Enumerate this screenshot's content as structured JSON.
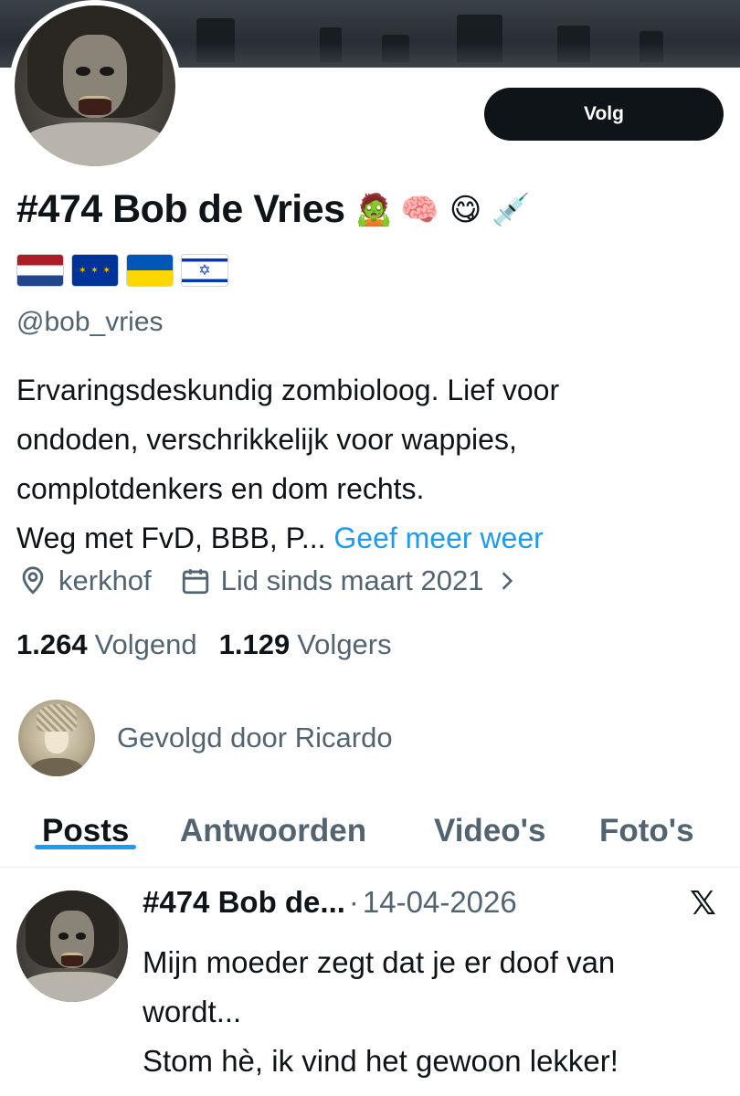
{
  "profile": {
    "display_name": "#474 Bob de Vries",
    "name_emojis": [
      "🧟",
      "🧠",
      "😋",
      "💉"
    ],
    "flags": [
      {
        "icon": "netherlands-flag-icon"
      },
      {
        "icon": "eu-flag-icon",
        "glyph": "✶ ✶ ✶"
      },
      {
        "icon": "ukraine-flag-icon"
      },
      {
        "icon": "israel-flag-icon",
        "glyph": "✡"
      }
    ],
    "handle": "@bob_vries",
    "follow_label": "Volg",
    "bio_lines": [
      "Ervaringsdeskundig zombioloog. Lief voor",
      "ondoden, verschrikkelijk voor wappies,",
      "complotdenkers en dom rechts."
    ],
    "bio_truncated": "Weg met FvD, BBB, P...",
    "bio_more": "Geef meer weer",
    "location": "kerkhof",
    "joined": "Lid sinds maart 2021",
    "following_count": "1.264",
    "following_label": "Volgend",
    "followers_count": "1.129",
    "followers_label": "Volgers",
    "followed_by": "Gevolgd door Ricardo"
  },
  "tabs": [
    {
      "label": "Posts",
      "active": true
    },
    {
      "label": "Antwoorden",
      "active": false
    },
    {
      "label": "Video's",
      "active": false
    },
    {
      "label": "Foto's",
      "active": false
    }
  ],
  "post": {
    "author": "#474 Bob de...",
    "separator": "·",
    "date": "14-04-2026",
    "platform_icon": "x-logo-icon",
    "platform_glyph": "𝕏",
    "lines": [
      "Mijn moeder zegt dat je er doof van",
      "wordt...",
      "Stom hè, ik vind het gewoon lekker!"
    ]
  },
  "colors": {
    "accent": "#1d9bf0",
    "text": "#0f1419",
    "muted": "#536471"
  }
}
